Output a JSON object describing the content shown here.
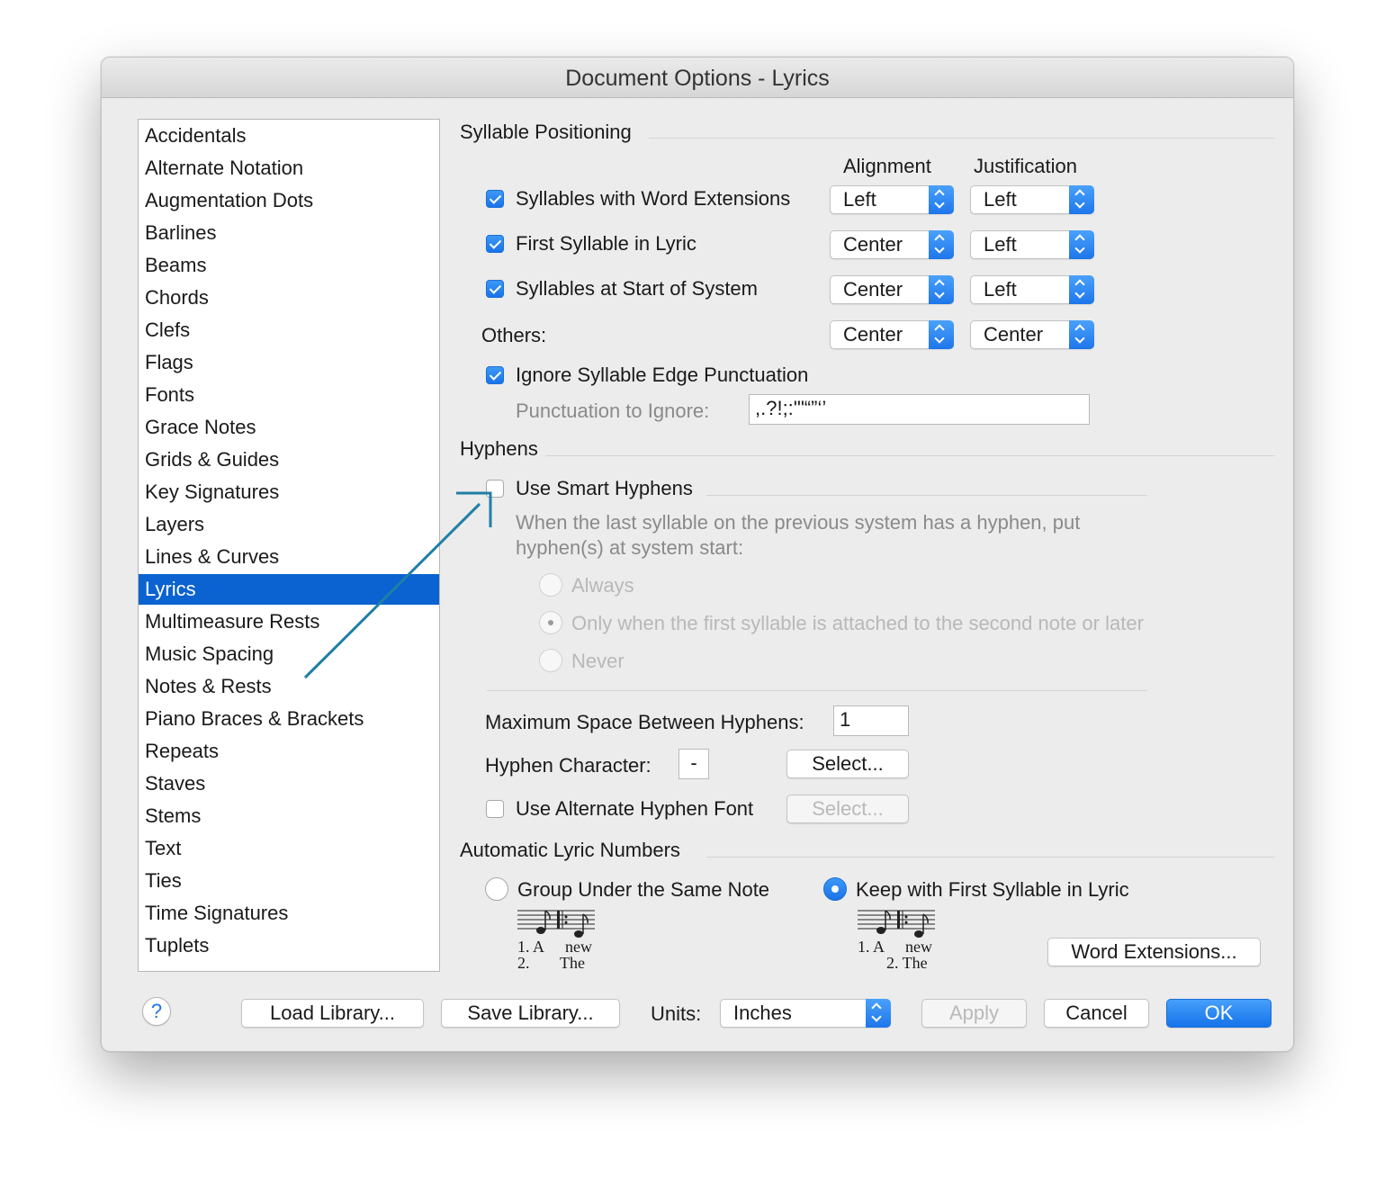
{
  "window": {
    "title": "Document Options - Lyrics"
  },
  "categories": [
    "Accidentals",
    "Alternate Notation",
    "Augmentation Dots",
    "Barlines",
    "Beams",
    "Chords",
    "Clefs",
    "Flags",
    "Fonts",
    "Grace Notes",
    "Grids & Guides",
    "Key Signatures",
    "Layers",
    "Lines & Curves",
    "Lyrics",
    "Multimeasure Rests",
    "Music Spacing",
    "Notes & Rests",
    "Piano Braces & Brackets",
    "Repeats",
    "Staves",
    "Stems",
    "Text",
    "Ties",
    "Time Signatures",
    "Tuplets"
  ],
  "selected_category": "Lyrics",
  "syllable": {
    "heading": "Syllable Positioning",
    "col_alignment": "Alignment",
    "col_justification": "Justification",
    "rows": [
      {
        "label": "Syllables with Word Extensions",
        "checked": true,
        "alignment": "Left",
        "justification": "Left"
      },
      {
        "label": "First Syllable in Lyric",
        "checked": true,
        "alignment": "Center",
        "justification": "Left"
      },
      {
        "label": "Syllables at Start of System",
        "checked": true,
        "alignment": "Center",
        "justification": "Left"
      }
    ],
    "others_label": "Others:",
    "others_alignment": "Center",
    "others_justification": "Center",
    "ignore_label": "Ignore Syllable Edge Punctuation",
    "punct_label": "Punctuation to Ignore:",
    "punct_value": ",.?!;:'\"“”‘’"
  },
  "hyphens": {
    "heading": "Hyphens",
    "smart_label": "Use Smart Hyphens",
    "desc_line1": "When the last syllable on the previous system has a hyphen, put",
    "desc_line2": "hyphen(s) at system start:",
    "opt_always": "Always",
    "opt_only": "Only when the first syllable is attached to the second note or later",
    "opt_never": "Never",
    "max_space_label": "Maximum Space Between Hyphens:",
    "max_space_value": "1",
    "char_label": "Hyphen Character:",
    "char_value": "-",
    "select_label": "Select...",
    "alt_font_label": "Use Alternate Hyphen Font",
    "select2_label": "Select..."
  },
  "lyric_numbers": {
    "heading": "Automatic Lyric Numbers",
    "group_label": "Group Under the Same Note",
    "keep_label": "Keep with First Syllable in Lyric",
    "ex1_line1a": "1. A",
    "ex1_line1b": "new",
    "ex1_line2a": "2.",
    "ex1_line2b": "The",
    "ex2_line1a": "1. A",
    "ex2_line1b": "new",
    "ex2_line2": "2. The",
    "word_ext_button": "Word Extensions..."
  },
  "footer": {
    "help": "?",
    "load": "Load Library...",
    "save": "Save Library...",
    "units_label": "Units:",
    "units_value": "Inches",
    "apply": "Apply",
    "cancel": "Cancel",
    "ok": "OK"
  },
  "colors": {
    "accent": "#1a73e8",
    "selection": "#0a63d0",
    "annotation_arrow": "#1f7fa6"
  }
}
